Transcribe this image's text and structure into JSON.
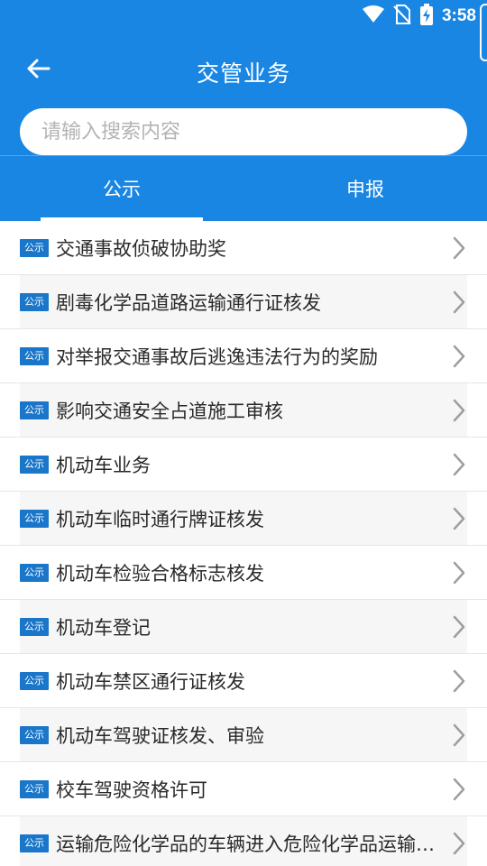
{
  "status": {
    "time": "3:58"
  },
  "toolbar": {
    "title": "交管业务"
  },
  "search": {
    "placeholder": "请输入搜索内容",
    "value": ""
  },
  "tabs": [
    {
      "label": "公示",
      "selected": true
    },
    {
      "label": "申报",
      "selected": false
    }
  ],
  "list": {
    "badge": "公示",
    "items": [
      {
        "label": "交通事故侦破协助奖"
      },
      {
        "label": "剧毒化学品道路运输通行证核发"
      },
      {
        "label": "对举报交通事故后逃逸违法行为的奖励"
      },
      {
        "label": "影响交通安全占道施工审核"
      },
      {
        "label": "机动车业务"
      },
      {
        "label": "机动车临时通行牌证核发"
      },
      {
        "label": "机动车检验合格标志核发"
      },
      {
        "label": "机动车登记"
      },
      {
        "label": "机动车禁区通行证核发"
      },
      {
        "label": "机动车驾驶证核发、审验"
      },
      {
        "label": "校车驾驶资格许可"
      },
      {
        "label": "运输危险化学品的车辆进入危险化学品运输车辆限制通行区域审批"
      }
    ]
  },
  "colors": {
    "primary": "#1a86e3",
    "badge": "#1a76c9",
    "chevron": "#9e9e9e"
  }
}
